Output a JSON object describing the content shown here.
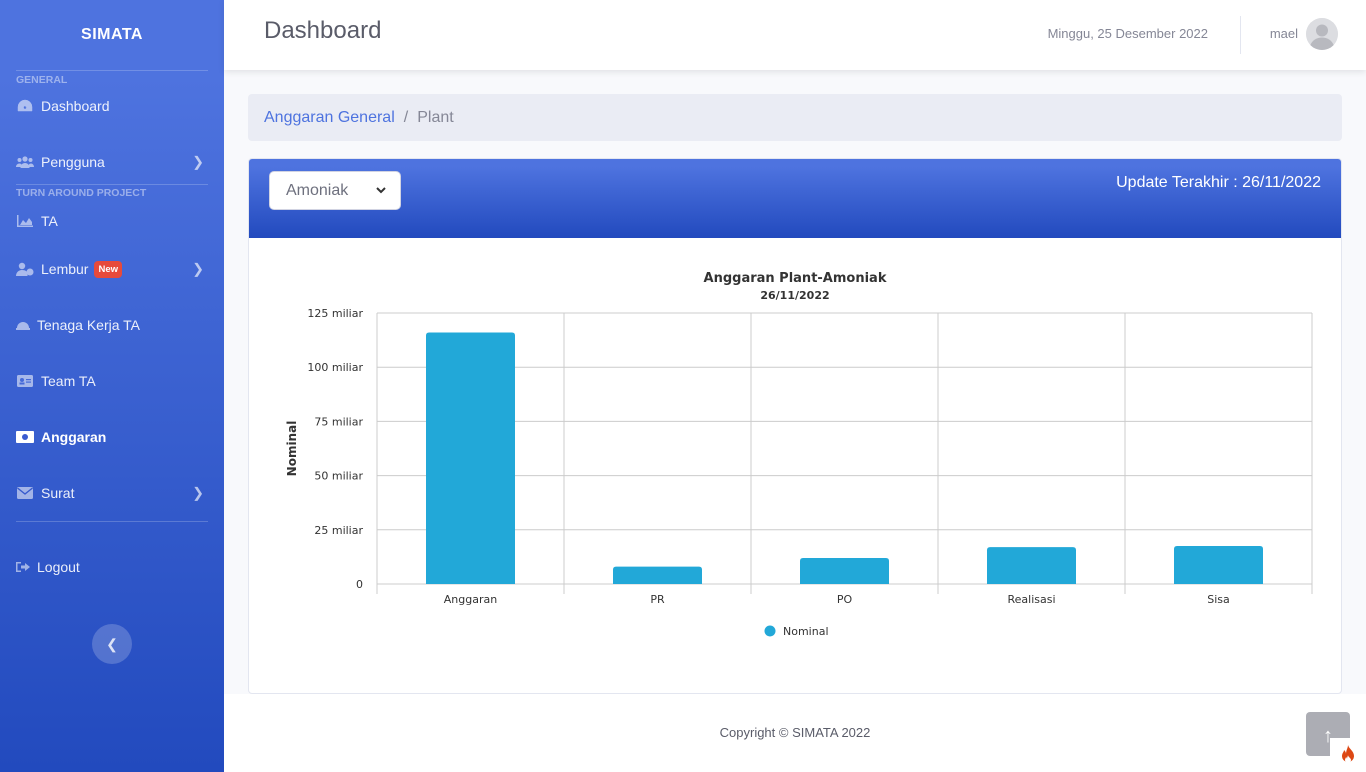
{
  "sidebar": {
    "brand": "SIMATA",
    "headings": {
      "general": "GENERAL",
      "turn_around": "TURN AROUND PROJECT"
    },
    "items": [
      {
        "label": "Dashboard",
        "icon": "tachometer-icon"
      },
      {
        "label": "Pengguna",
        "icon": "users-icon"
      },
      {
        "label": "TA",
        "icon": "area-chart-icon"
      },
      {
        "label": "Lembur",
        "icon": "user-clock-icon",
        "badge": "New"
      },
      {
        "label": "Tenaga Kerja TA",
        "icon": "hard-hat-icon"
      },
      {
        "label": "Team TA",
        "icon": "id-card-icon"
      },
      {
        "label": "Anggaran",
        "icon": "money-bill-icon",
        "active": true
      },
      {
        "label": "Surat",
        "icon": "envelope-icon"
      },
      {
        "label": "Logout",
        "icon": "sign-out-icon"
      }
    ]
  },
  "topbar": {
    "title": "Dashboard",
    "date": "Minggu, 25 Desember 2022",
    "user": "mael"
  },
  "breadcrumb": {
    "parent": "Anggaran General",
    "separator": "/",
    "current": "Plant"
  },
  "filter": {
    "selected": "Amoniak",
    "last_update": "Update Terakhir : 26/11/2022"
  },
  "chart_data": {
    "type": "bar",
    "title": "Anggaran Plant-Amoniak",
    "subtitle": "26/11/2022",
    "xlabel": "",
    "ylabel": "Nominal",
    "categories": [
      "Anggaran",
      "PR",
      "PO",
      "Realisasi",
      "Sisa"
    ],
    "series": [
      {
        "name": "Nominal",
        "values": [
          116000000000,
          8000000000,
          12000000000,
          17000000000,
          17500000000
        ],
        "color": "#22a8d8"
      }
    ],
    "ylim": [
      0,
      125000000000
    ],
    "yticks": [
      "0",
      "25 miliar",
      "50 miliar",
      "75 miliar",
      "100 miliar",
      "125 miliar"
    ],
    "grid": true,
    "legend": "bottom"
  },
  "footer": {
    "copyright": "Copyright © SIMATA 2022"
  },
  "colors": {
    "primary": "#4e73df",
    "primary_dark": "#224abe",
    "bar": "#22a8d8",
    "badge": "#e74a3b"
  }
}
